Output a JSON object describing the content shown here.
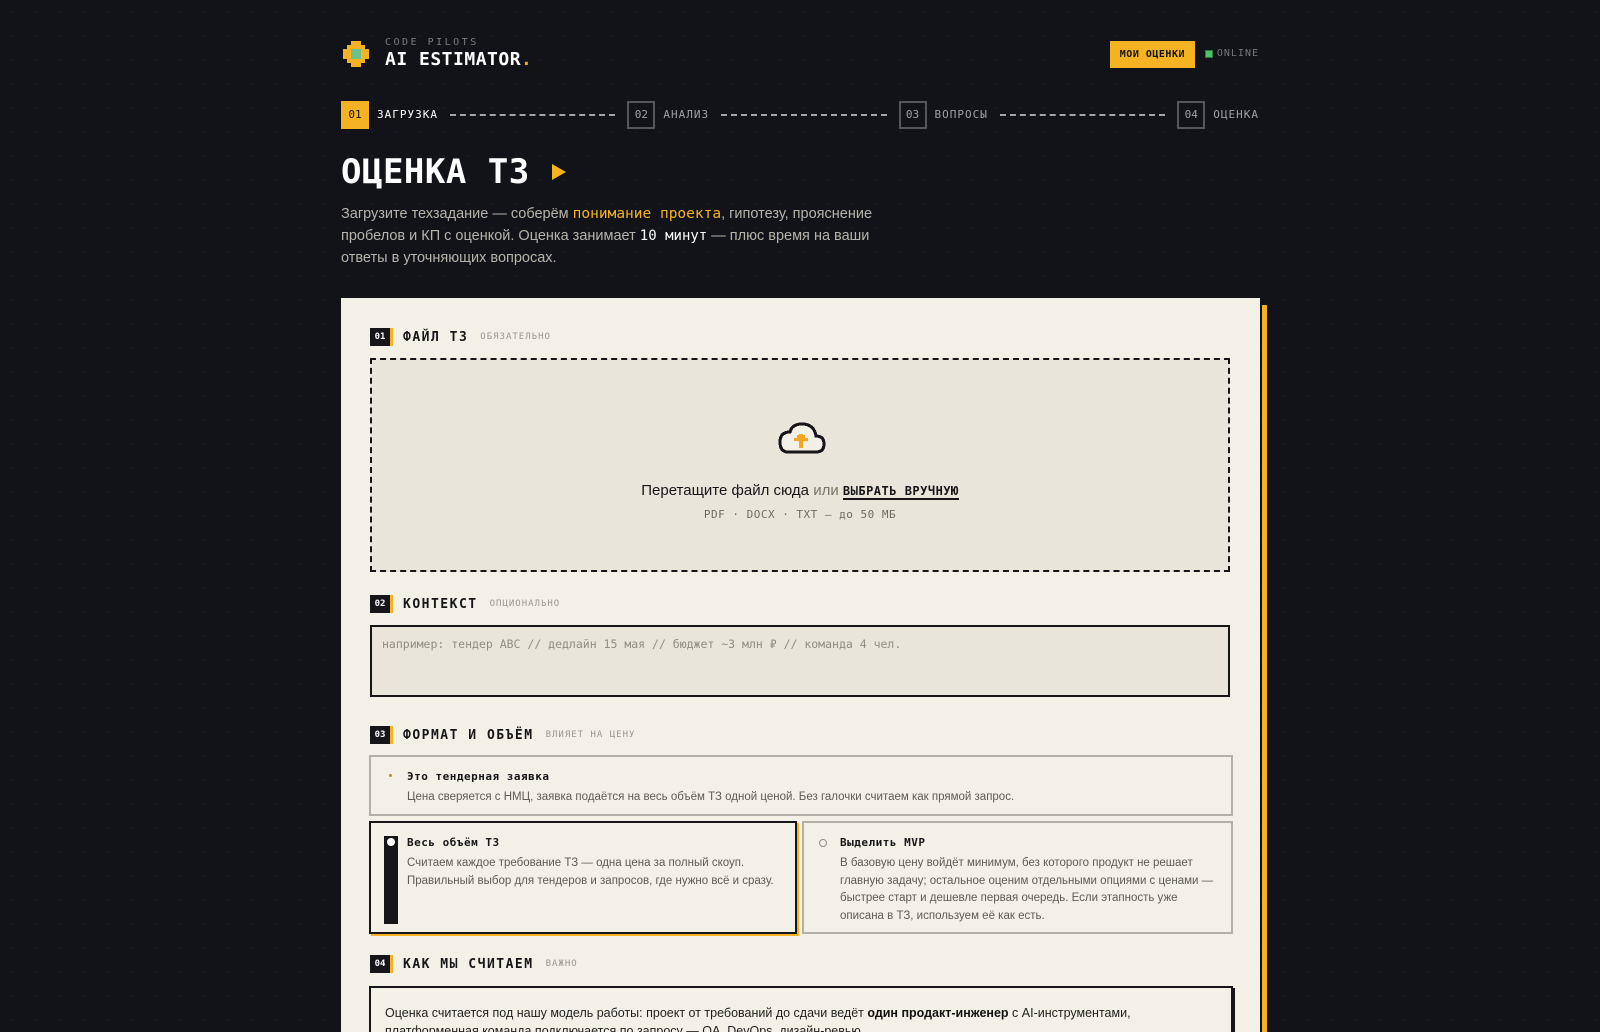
{
  "brand": {
    "sub": "CODE PILOTS",
    "title": "AI ESTIMATOR",
    "dot": "."
  },
  "header": {
    "my_estimates": "МОИ ОЦЕНКИ",
    "status": "ONLINE"
  },
  "steps": [
    {
      "num": "01",
      "label": "ЗАГРУЗКА"
    },
    {
      "num": "02",
      "label": "АНАЛИЗ"
    },
    {
      "num": "03",
      "label": "ВОПРОСЫ"
    },
    {
      "num": "04",
      "label": "ОЦЕНКА"
    }
  ],
  "page": {
    "title": "ОЦЕНКА ТЗ",
    "sub_1": "Загрузите техзадание — соберём ",
    "sub_hl": "понимание проекта",
    "sub_2": ", гипотезу, прояснение пробелов и КП с оценкой. Оценка занимает ",
    "sub_time": "10 минут",
    "sub_3": " — плюс время на ваши ответы в уточняющих вопросах."
  },
  "sections": {
    "file": {
      "num": "01",
      "title": "ФАЙЛ ТЗ",
      "tag": "ОБЯЗАТЕЛЬНО"
    },
    "context": {
      "num": "02",
      "title": "КОНТЕКСТ",
      "tag": "ОПЦИОНАЛЬНО"
    },
    "format": {
      "num": "03",
      "title": "ФОРМАТ И ОБЪЁМ",
      "tag": "ВЛИЯЕТ НА ЦЕНУ"
    },
    "calc": {
      "num": "04",
      "title": "КАК МЫ СЧИТАЕМ",
      "tag": "ВАЖНО"
    }
  },
  "dropzone": {
    "text": "Перетащите файл сюда",
    "or": " или ",
    "pick": "ВЫБРАТЬ ВРУЧНУЮ",
    "hint": "PDF · DOCX · TXT — до 50 МБ"
  },
  "context": {
    "placeholder": "например: тендер ABC // дедлайн 15 мая // бюджет ~3 млн ₽ // команда 4 чел.",
    "value": ""
  },
  "options": {
    "tender": {
      "title": "Это тендерная заявка",
      "desc": "Цена сверяется с НМЦ, заявка подаётся на весь объём ТЗ одной ценой. Без галочки считаем как прямой запрос."
    },
    "full": {
      "title": "Весь объём ТЗ",
      "desc": "Считаем каждое требование ТЗ — одна цена за полный скоуп. Правильный выбор для тендеров и запросов, где нужно всё и сразу."
    },
    "mvp": {
      "title": "Выделить MVP",
      "desc": "В базовую цену войдёт минимум, без которого продукт не решает главную задачу; остальное оценим отдельными опциями с ценами — быстрее старт и дешевле первая очередь. Если этапность уже описана в ТЗ, используем её как есть."
    }
  },
  "calc": {
    "text_1": "Оценка считается под нашу модель работы: проект от требований до сдачи ведёт ",
    "bold": "один продакт-инженер",
    "text_2": " с AI-инструментами, платформенная команда подключается по запросу — QA, DevOps, дизайн-ревью."
  },
  "colors": {
    "accent": "#f5b324",
    "background": "#121318",
    "card": "#f3f0e7",
    "ink": "#16161a",
    "online": "#4cc468"
  }
}
